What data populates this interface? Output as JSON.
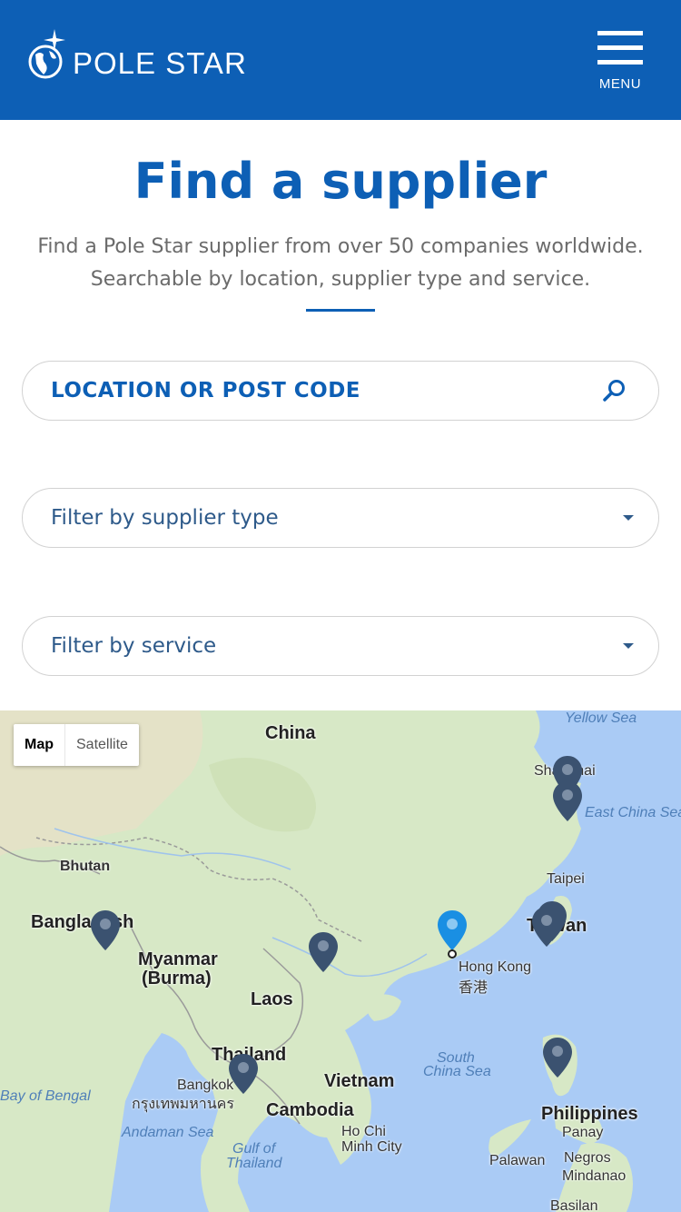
{
  "header": {
    "brand": "POLE STAR",
    "menu_label": "MENU",
    "background": "#0d5fb5",
    "logo_icon": "globe-star-icon",
    "menu_icon": "hamburger-icon"
  },
  "main": {
    "title": "Find a supplier",
    "subtitle_line1": "Find a Pole Star supplier from over 50 companies worldwide.",
    "subtitle_line2": "Searchable by location, supplier type and service.",
    "accent": "#0d5fb5"
  },
  "search": {
    "placeholder": "LOCATION OR POST CODE",
    "icon": "search-icon"
  },
  "filters": {
    "supplier_type": "Filter by supplier type",
    "service": "Filter by service",
    "icon": "caret-down-icon"
  },
  "map": {
    "type_map": "Map",
    "type_satellite": "Satellite",
    "labels": {
      "china": "China",
      "yellow_sea": "Yellow Sea",
      "shanghai": "Shanghai",
      "east_china_sea": "East China Sea",
      "bhutan": "Bhutan",
      "taipei": "Taipei",
      "bangladesh": "Bangladesh",
      "taiwan": "Taiwan",
      "myanmar": "Myanmar",
      "burma": "(Burma)",
      "hong_kong": "Hong Kong",
      "hong_kong_local": "香港",
      "laos": "Laos",
      "thailand": "Thailand",
      "vietnam": "Vietnam",
      "south_china_sea_1": "South",
      "south_china_sea_2": "China Sea",
      "bangkok": "Bangkok",
      "bangkok_local": "กรุงเทพมหานคร",
      "bay_of_bengal": "Bay of Bengal",
      "cambodia": "Cambodia",
      "philippines": "Philippines",
      "andaman_sea": "Andaman Sea",
      "gulf_of_thailand_1": "Gulf of",
      "gulf_of_thailand_2": "Thailand",
      "ho_chi_minh_1": "Ho Chi",
      "ho_chi_minh_2": "Minh City",
      "panay": "Panay",
      "palawan": "Palawan",
      "negros": "Negros",
      "mindanao": "Mindanao",
      "basilan": "Basilan"
    },
    "pin_color": "#3b5270",
    "selected_pin_color": "#1a8fe3",
    "marker_icon": "map-pin-icon"
  }
}
